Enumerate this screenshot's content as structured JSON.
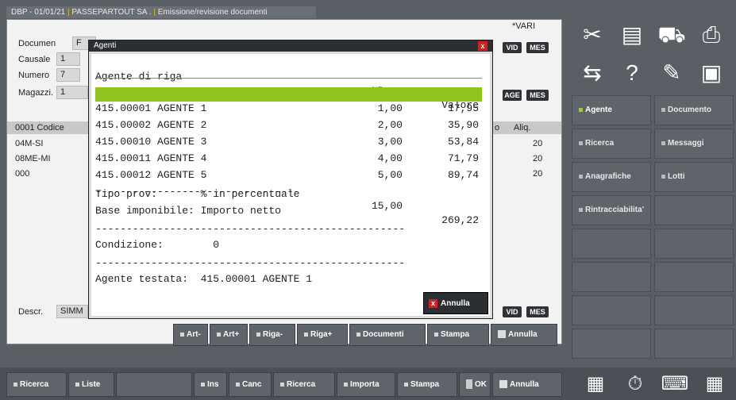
{
  "window": {
    "title_parts": [
      "DBP - 01/01/21",
      "PASSEPARTOUT SA .",
      "Emissione/revisione documenti"
    ]
  },
  "form": {
    "vari_label": "*VARI",
    "documento": {
      "label": "Documen",
      "value": "F"
    },
    "causale": {
      "label": "Causale",
      "value": "1"
    },
    "numero": {
      "label": "Numero",
      "value": "7"
    },
    "magazzino": {
      "label": "Magazzi.",
      "value": "1"
    },
    "tags": {
      "vid": "VID",
      "mes": "MES",
      "age": "AGE"
    },
    "grid": {
      "header_left": "0001  Codice",
      "header_mid": "o",
      "header_right": "Aliq.",
      "rows": [
        {
          "code": "04M-SI",
          "aliq": "20"
        },
        {
          "code": "08ME-MI",
          "aliq": "20"
        },
        {
          "code": "000",
          "aliq": "20"
        }
      ]
    },
    "descr": {
      "label": "Descr.",
      "value": "SIMM"
    }
  },
  "dialog": {
    "title": "Agenti",
    "close": "x",
    "header": {
      "agente": "Agente di riga",
      "prov": "%Prov",
      "valore": "Valore"
    },
    "rows": [
      {
        "agente": "415.00001 AGENTE 1",
        "prov": "1,00",
        "valore": "17,95"
      },
      {
        "agente": "415.00002 AGENTE 2",
        "prov": "2,00",
        "valore": "35,90"
      },
      {
        "agente": "415.00010 AGENTE 3",
        "prov": "3,00",
        "valore": "53,84"
      },
      {
        "agente": "415.00011 AGENTE 4",
        "prov": "4,00",
        "valore": "71,79"
      },
      {
        "agente": "415.00012 AGENTE 5",
        "prov": "5,00",
        "valore": "89,74"
      }
    ],
    "totals": {
      "dashes": "---------------------------------",
      "prov": "15,00",
      "valore": "269,22"
    },
    "tipo_prov": "Tipo prov:       % in percentuale",
    "base_imponibile": "Base imponibile: Importo netto",
    "sep_line": "--------------------------------------------------",
    "condizione": "Condizione:        0",
    "agente_testata": "Agente testata:  415.00001 AGENTE 1",
    "annulla": "Annulla"
  },
  "mid_buttons": [
    "Art-",
    "Art+",
    "Riga-",
    "Riga+",
    "Documenti",
    "Stampa",
    "Annulla"
  ],
  "bottom_buttons": [
    "Ricerca",
    "Liste",
    "Ins",
    "Canc",
    "Ricerca",
    "Importa",
    "Stampa",
    "OK",
    "Annulla"
  ],
  "right_panel": {
    "buttons": [
      [
        "Agente",
        "Documento"
      ],
      [
        "Ricerca",
        "Messaggi"
      ],
      [
        "Anagrafiche",
        "Lotti"
      ],
      [
        "Rintracciabilita'",
        ""
      ]
    ],
    "top_icons": [
      "scissors-icon",
      "paste-icon",
      "truck-icon",
      "printer-icon",
      "move-icon",
      "help-icon",
      "edit-icon",
      "box-icon"
    ],
    "bottom_icons": [
      "calculator-icon",
      "stopwatch-icon",
      "keyboard-icon",
      "grid-icon"
    ]
  }
}
